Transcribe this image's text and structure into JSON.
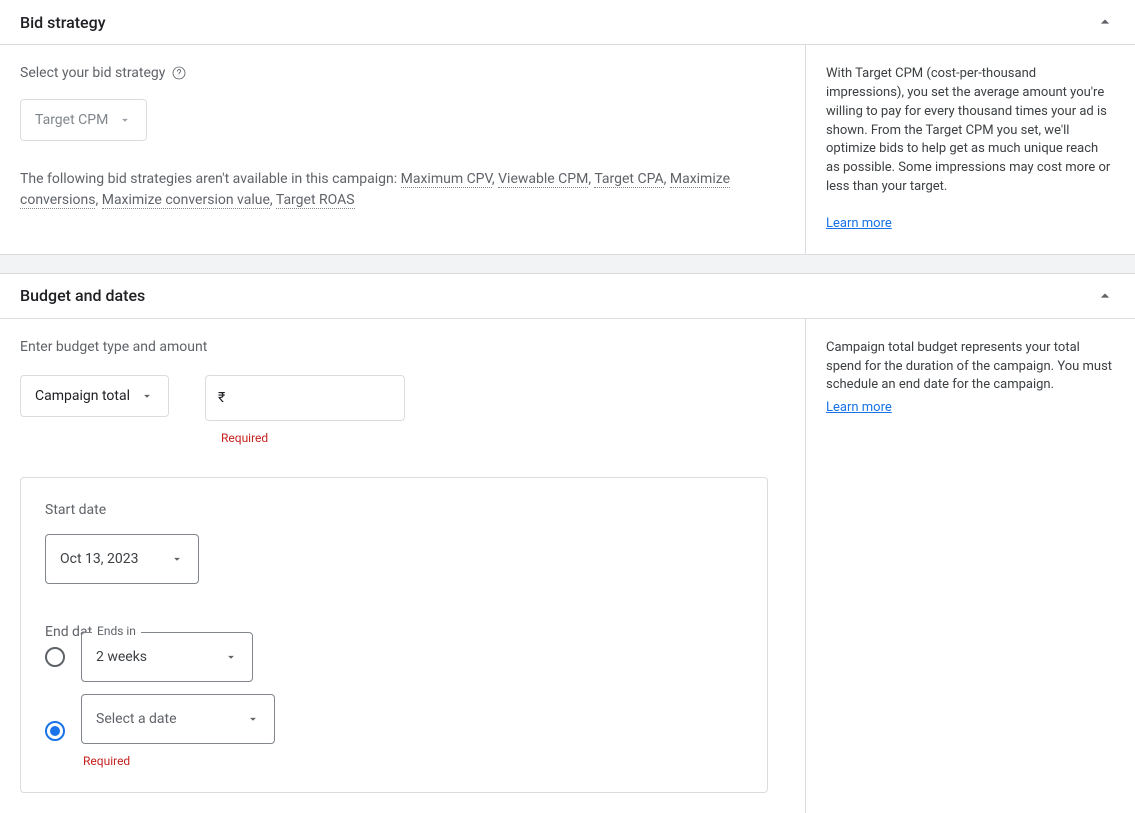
{
  "bid": {
    "title": "Bid strategy",
    "select_label": "Select your bid strategy",
    "strategy_value": "Target CPM",
    "note_prefix": "The following bid strategies aren't available in this campaign: ",
    "na": [
      "Maximum CPV",
      "Viewable CPM",
      "Target CPA",
      "Maximize conversions",
      "Maximize conversion value",
      "Target ROAS"
    ],
    "info": "With Target CPM (cost-per-thousand impressions), you set the average amount you're willing to pay for every thousand times your ad is shown. From the Target CPM you set, we'll optimize bids to help get as much unique reach as possible. Some impressions may cost more or less than your target.",
    "learn_more": "Learn more"
  },
  "budget": {
    "title": "Budget and dates",
    "enter_label": "Enter budget type and amount",
    "type_value": "Campaign total",
    "currency_symbol": "₹",
    "required_text": "Required",
    "info": "Campaign total budget represents your total spend for the duration of the campaign. You must schedule an end date for the campaign.",
    "learn_more": "Learn more",
    "start_label": "Start date",
    "start_value": "Oct 13, 2023",
    "end_label": "End date",
    "ends_in_label": "Ends in",
    "ends_in_value": "2 weeks",
    "select_date_value": "Select a date"
  }
}
